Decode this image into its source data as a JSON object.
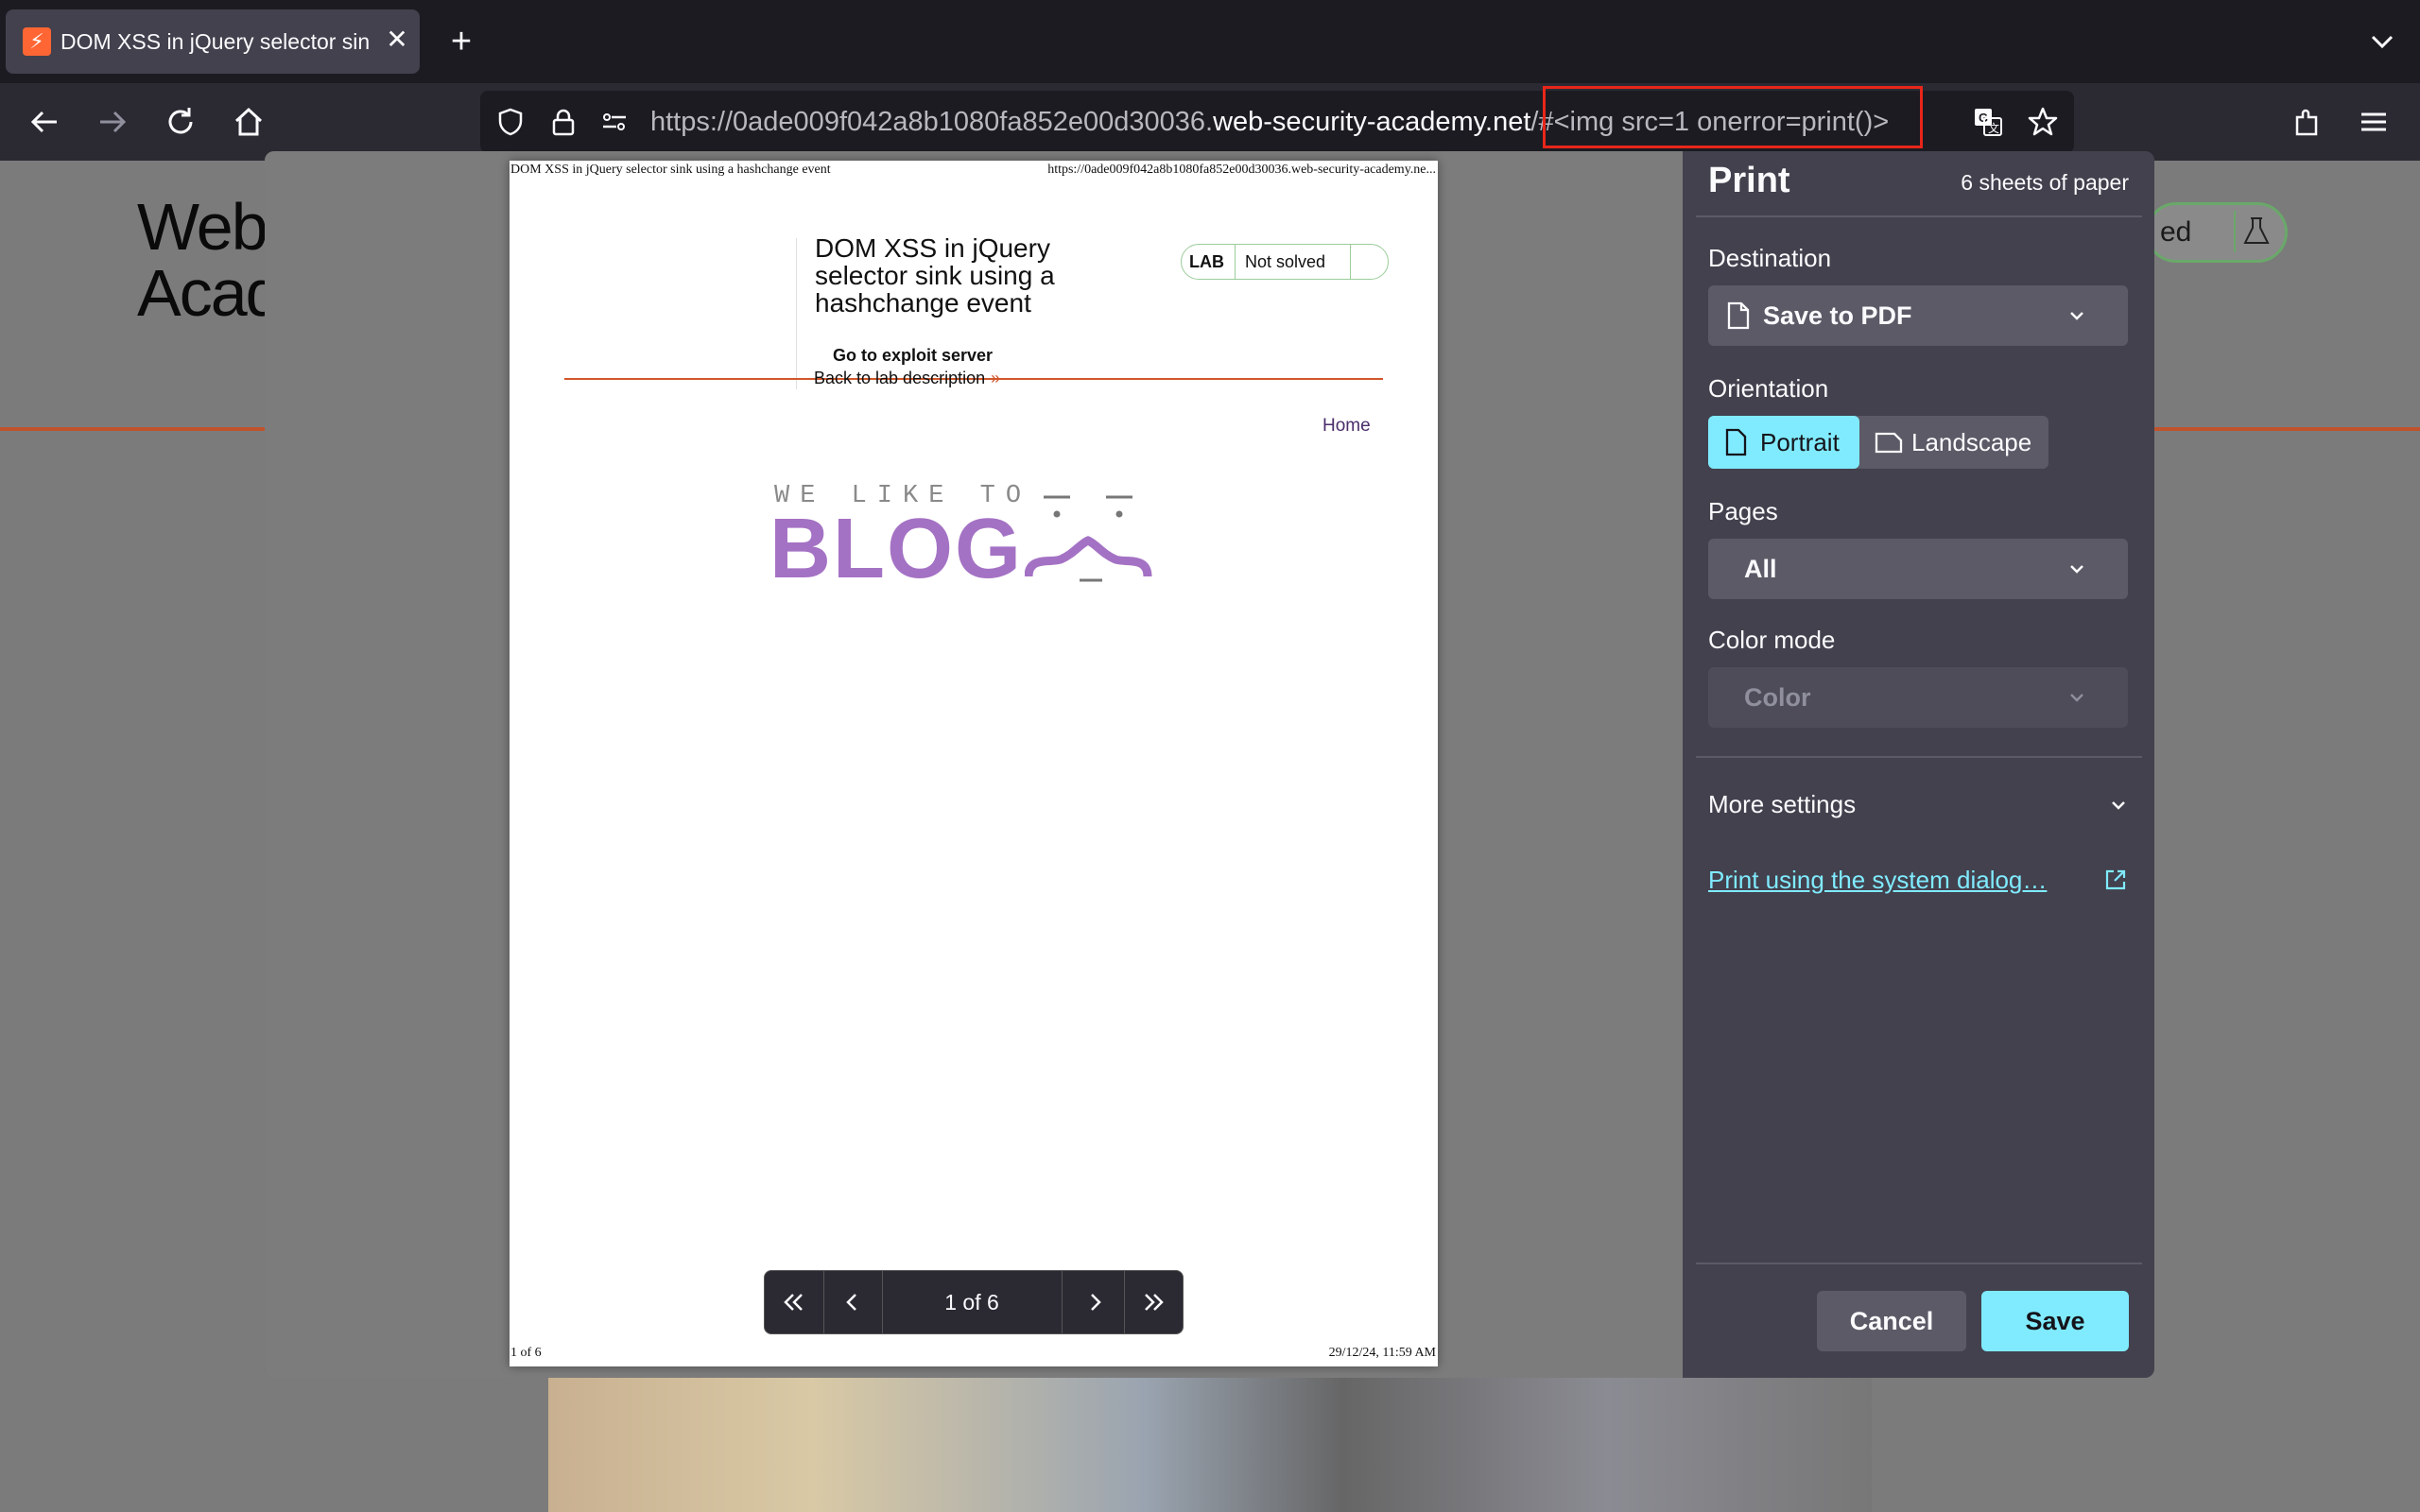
{
  "browser": {
    "tab_title": "DOM XSS in jQuery selector sin",
    "url_prefix": "https://0ade009f042a8b1080fa852e00d30036.",
    "url_host": "web-security-academy.net",
    "url_fragment": "/#<img src=1 onerror=print()>"
  },
  "background_page": {
    "logo_line1": "Web",
    "logo_line2": "Acad",
    "badge_fragment": "ed"
  },
  "preview": {
    "header_left": "DOM XSS in jQuery selector sink using a hashchange event",
    "header_right": "https://0ade009f042a8b1080fa852e00d30036.web-security-academy.ne...",
    "lab_title": "DOM XSS in jQuery selector sink using a hashchange event",
    "lab_label": "LAB",
    "lab_status": "Not solved",
    "exploit_link": "Go to exploit server",
    "back_link": "Back to lab description",
    "home_link": "Home",
    "blog_tagline": "WE LIKE TO",
    "blog_word": "BLOG",
    "footer_left": "1 of 6",
    "footer_right": "29/12/24, 11:59 AM"
  },
  "pager": {
    "text": "1 of 6"
  },
  "print_panel": {
    "title": "Print",
    "sheets": "6 sheets of paper",
    "destination_label": "Destination",
    "destination_value": "Save to PDF",
    "orientation_label": "Orientation",
    "portrait_label": "Portrait",
    "landscape_label": "Landscape",
    "pages_label": "Pages",
    "pages_value": "All",
    "color_mode_label": "Color mode",
    "color_mode_value": "Color",
    "more_settings": "More settings",
    "system_dialog_link": "Print using the system dialog…",
    "cancel_label": "Cancel",
    "save_label": "Save"
  },
  "colors": {
    "accent": "#80ebff",
    "panel_bg": "#42414d",
    "url_highlight": "#e8261a",
    "blog_purple": "#a472c4"
  }
}
